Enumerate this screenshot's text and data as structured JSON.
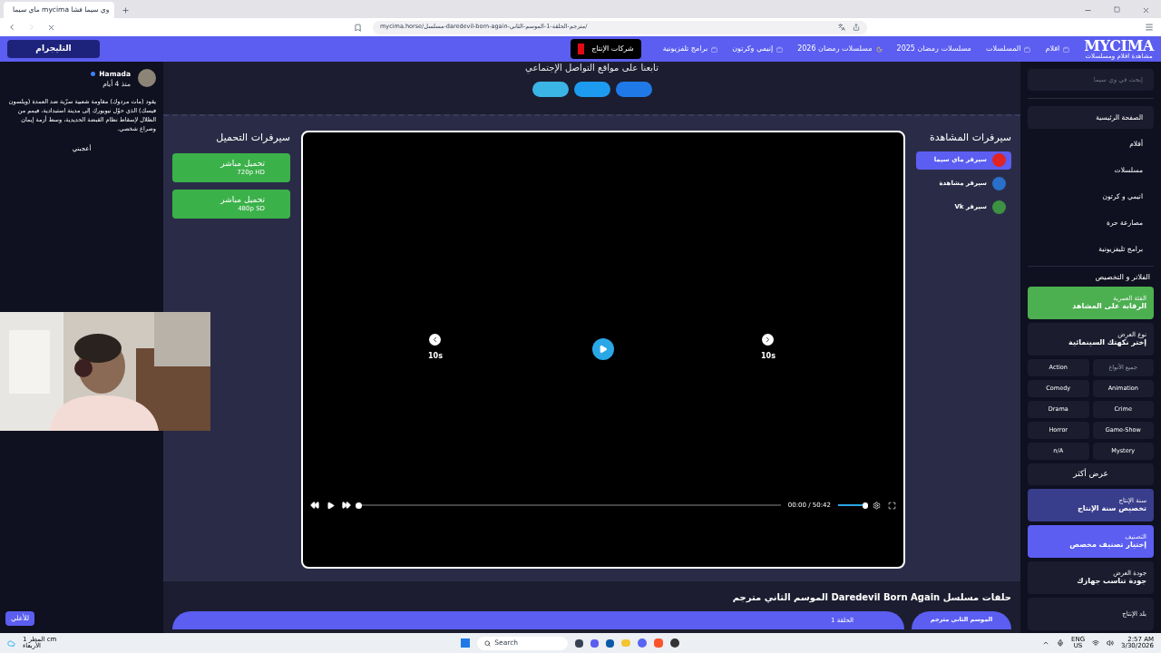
{
  "browser": {
    "tab_title": "ماي سيما mycima وي سيما فشا",
    "url": "mycima.horse/مسلسل-daredevil-born-again-مترجم-الحلقة-1-الموسم-الثاني/"
  },
  "nav": {
    "logo": "MYCIMA",
    "tagline": "مشاهدة افلام ومسلسلات",
    "items": [
      {
        "label": "افلام",
        "kind": "menu"
      },
      {
        "label": "المسلسلات",
        "kind": "menu"
      },
      {
        "label": "مسلسلات رمضان 2025",
        "kind": "plain"
      },
      {
        "label": "مسلسلات رمضان 2026",
        "kind": "moon"
      },
      {
        "label": "إنيمي وكرتون",
        "kind": "menu"
      },
      {
        "label": "برامج تلفزيونية",
        "kind": "menu"
      }
    ],
    "companies_button": "شركات الإنتاج",
    "telegram_button": "التليجرام"
  },
  "comment": {
    "author": "Hamada",
    "time": "منذ 4 أيام",
    "text": "يقود (مات مردوك) مقاومة شعبية سرّية ضد العمدة (ويلسون فيسك) الذي حوّل نيويورك إلى مدينة استبدادية، فيمم من الظلال لإسقاط نظام القبضة الحديدية، وسط أزمة إيمان وصراع شخصي.",
    "like": "أعجبني"
  },
  "social": {
    "heading": "تابعنا على مواقع التواصل الإجتماعي",
    "buttons": [
      {
        "color": "#3bb4e6"
      },
      {
        "color": "#1d9bf0"
      },
      {
        "color": "#1f7ae8"
      }
    ]
  },
  "download_servers": {
    "heading": "سيرفرات التحميل",
    "items": [
      {
        "label": "تحميل مباشر",
        "quality": "720p HD"
      },
      {
        "label": "تحميل مباشر",
        "quality": "480p SD"
      }
    ]
  },
  "player": {
    "skip_back": "10s",
    "skip_forward": "10s",
    "time": "00:00 / 50:42",
    "progress": {
      "level": 0.0
    },
    "volume": {
      "level": 1.0
    }
  },
  "watch_servers": {
    "heading": "سيرفرات المشاهدة",
    "items": [
      {
        "label": "سيرفر ماي سيما",
        "color": "#e02424",
        "selected": true
      },
      {
        "label": "سيرفر مشاهدة",
        "color": "#2a6fc9",
        "selected": false
      },
      {
        "label": "سيرفر Vk",
        "color": "#3d9142",
        "selected": false
      }
    ]
  },
  "episodes": {
    "heading": "حلقات مسلسل Daredevil Born Again الموسم الثاني مترجم",
    "episode": "الحلقة 1",
    "season": "الموسم الثاني مترجم"
  },
  "sidebar": {
    "search": {
      "placeholder": "إبحث في وي سيما"
    },
    "items": [
      {
        "label": "الصفحة الرئيسية",
        "selected": true
      },
      {
        "label": "أفلام",
        "selected": false
      },
      {
        "label": "مسلسلات",
        "selected": false
      },
      {
        "label": "انيمي و كرتون",
        "selected": false
      },
      {
        "label": "مصارعة حرة",
        "selected": false
      },
      {
        "label": "برامج تليفزيونية",
        "selected": false
      }
    ],
    "filters_heading": "الفلاتر و التخصيص",
    "filters": [
      {
        "kind": "card",
        "caption": "الفئة العمرية",
        "title": "الرقابة على المشاهد",
        "color": "#4caf50"
      },
      {
        "kind": "card",
        "caption": "نوع العرض",
        "title": "إختر نكهتك السينمائية",
        "color": "#1b1c2e"
      },
      {
        "kind": "genres",
        "genres": [
          {
            "label": "جميع الأنواع",
            "disabled": true
          },
          {
            "label": "Action",
            "disabled": false
          },
          {
            "label": "Animation",
            "disabled": false
          },
          {
            "label": "Comedy",
            "disabled": false
          },
          {
            "label": "Crime",
            "disabled": false
          },
          {
            "label": "Drama",
            "disabled": false
          },
          {
            "label": "Game-Show",
            "disabled": false
          },
          {
            "label": "Horror",
            "disabled": false
          },
          {
            "label": "Mystery",
            "disabled": false
          },
          {
            "label": "n/A",
            "disabled": false
          }
        ],
        "more": "عرض أكثر"
      },
      {
        "kind": "card",
        "caption": "سنة الإنتاج",
        "title": "تخصيص سنة الإنتاج",
        "color": "#383d8c"
      },
      {
        "kind": "card",
        "caption": "التصنيف",
        "title": "إختيار تصنيف مخصص",
        "color": "#5b5ef0"
      },
      {
        "kind": "card",
        "caption": "جودة العرض",
        "title": "جودة تناسب جهازك",
        "color": "#1b1c2e"
      },
      {
        "kind": "card",
        "caption": "بلد الإنتاج",
        "color": "#1b1c2e"
      }
    ]
  },
  "back_to_top": "للأعلي",
  "taskbar": {
    "weather": "المطر 1 cm",
    "weather_day": "الأربعاء",
    "search": "Search",
    "lang": "ENG",
    "region": "US",
    "time": "2:57 AM",
    "date": "3/30/2026"
  }
}
